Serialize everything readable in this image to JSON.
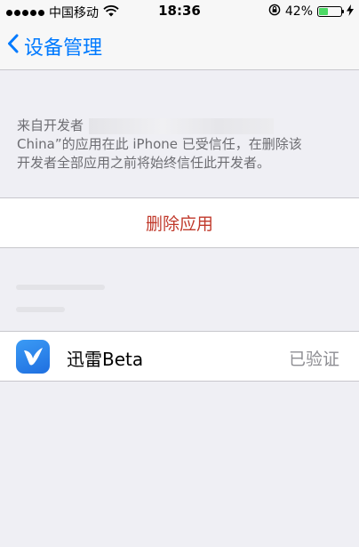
{
  "status_bar": {
    "carrier": "中国移动",
    "time": "18:36",
    "battery_percent": "42%",
    "battery_level": 0.42,
    "signal_icon": "signal-dots-icon",
    "wifi_icon": "wifi-icon",
    "rotation_lock_icon": "rotation-lock-icon",
    "charging_icon": "charging-bolt-icon"
  },
  "nav": {
    "back_label": "设备管理",
    "back_icon": "chevron-left-icon"
  },
  "description": {
    "line1_prefix": "来自开发者",
    "line2": "China”的应用在此 iPhone 已受信任，在删除该",
    "line3": "开发者全部应用之前将始终信任此开发者。"
  },
  "actions": {
    "delete_label": "删除应用"
  },
  "apps": [
    {
      "name": "迅雷Beta",
      "status": "已验证",
      "icon": "xunlei-bird-icon"
    }
  ],
  "colors": {
    "accent": "#007aff",
    "destructive": "#c0392b",
    "background": "#efeff4",
    "battery_fill": "#4cd964"
  }
}
